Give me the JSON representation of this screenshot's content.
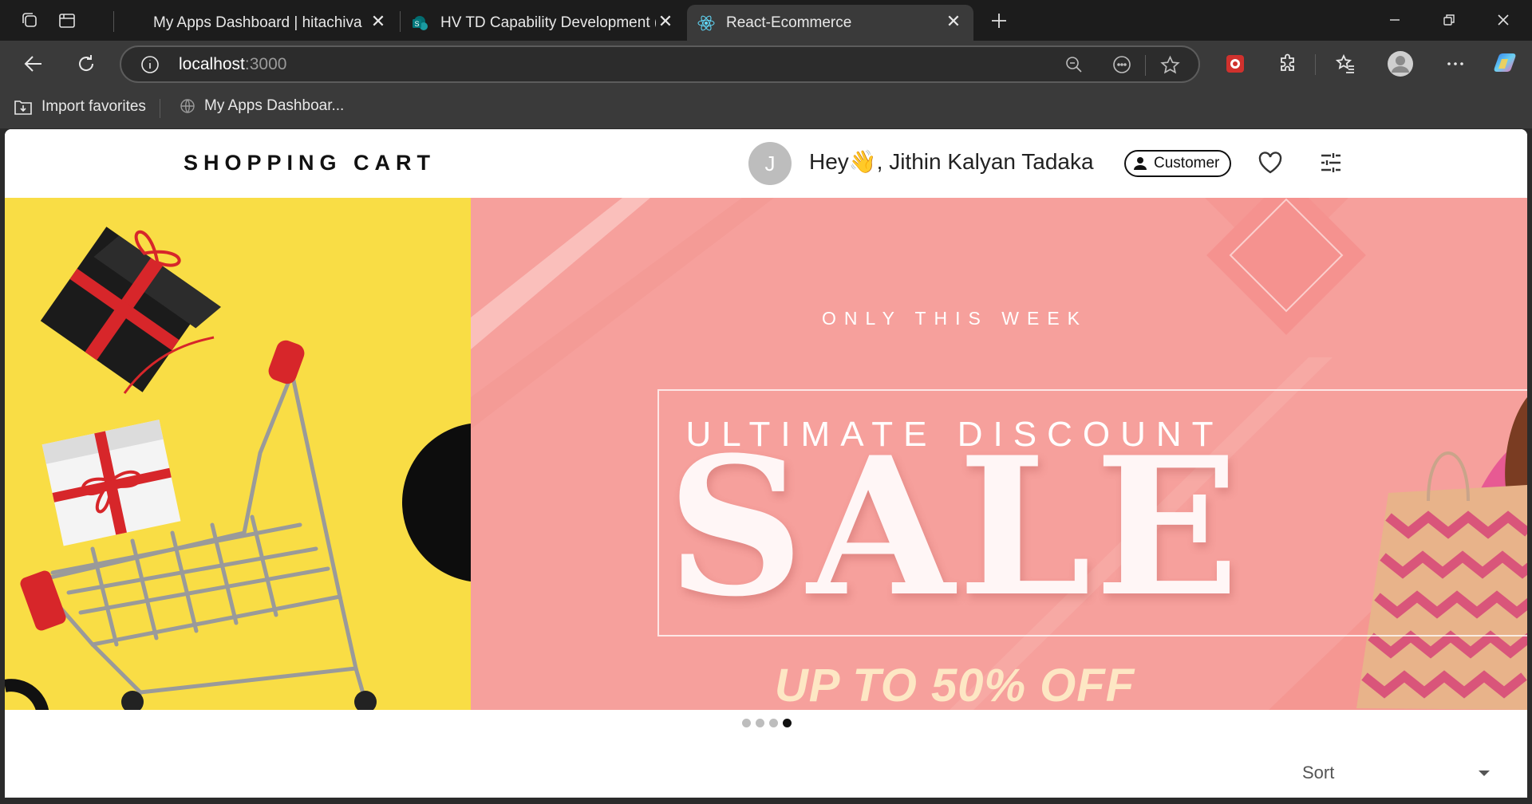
{
  "browser": {
    "tabs": [
      {
        "title": "My Apps Dashboard | hitachivantara",
        "active": false
      },
      {
        "title": "HV TD Capability Development (LMS)",
        "active": false
      },
      {
        "title": "React-Ecommerce",
        "active": true
      }
    ],
    "address": {
      "host": "localhost",
      "port": ":3000"
    },
    "favorites": [
      {
        "label": "Import favorites"
      },
      {
        "label": "My Apps Dashboar..."
      }
    ]
  },
  "header": {
    "brand": "SHOPPING CART",
    "avatar_initial": "J",
    "greeting": "Hey👋, Jithin Kalyan Tadaka",
    "role": "Customer"
  },
  "banner": {
    "subtitle": "ONLY THIS WEEK",
    "title": "ULTIMATE DISCOUNT",
    "headline": "SALE",
    "offer": "UP TO 50% OFF",
    "slides": 4,
    "active_slide": 4
  },
  "sort": {
    "label": "Sort"
  },
  "colors": {
    "banner_pink": "#f6a09c",
    "banner_yellow": "#f9dd45",
    "cart_red": "#d7262a"
  }
}
